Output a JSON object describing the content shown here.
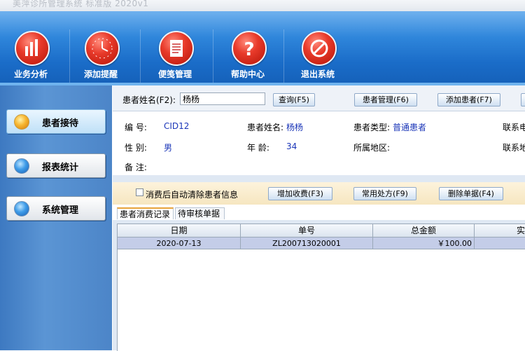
{
  "window": {
    "title": "美萍诊所管理系统 标准版   2020v1"
  },
  "toolbar": {
    "items": [
      {
        "label": "业务分析",
        "icon": "bar-chart-icon"
      },
      {
        "label": "添加提醒",
        "icon": "clock-icon"
      },
      {
        "label": "便笺管理",
        "icon": "notepad-icon"
      },
      {
        "label": "帮助中心",
        "icon": "help-icon"
      },
      {
        "label": "退出系统",
        "icon": "exit-icon"
      }
    ]
  },
  "sidebar": {
    "items": [
      {
        "label": "患者接待",
        "active": true
      },
      {
        "label": "报表统计",
        "active": false
      },
      {
        "label": "系统管理",
        "active": false
      }
    ]
  },
  "search": {
    "label": "患者姓名(F2):",
    "value": "杨杨",
    "query_btn": "查询(F5)",
    "manage_btn": "患者管理(F6)",
    "add_btn": "添加患者(F7)"
  },
  "patient": {
    "id_label": "编      号:",
    "id_value": "CID12",
    "name_label": "患者姓名:",
    "name_value": "杨杨",
    "type_label": "患者类型:",
    "type_value": "普通患者",
    "phone_label": "联系电",
    "sex_label": "性      别:",
    "sex_value": "男",
    "age_label": "年      龄:",
    "age_value": "34",
    "region_label": "所属地区:",
    "address_label": "联系地",
    "note_label": "备      注:"
  },
  "actions": {
    "auto_clear_label": "消费后自动清除患者信息",
    "add_fee_btn": "增加收费(F3)",
    "common_rx_btn": "常用处方(F9)",
    "delete_btn": "删除单据(F4)"
  },
  "tabs": [
    {
      "label": "患者消费记录",
      "active": true
    },
    {
      "label": "待审核单据",
      "active": false
    }
  ],
  "grid": {
    "columns": [
      "日期",
      "单号",
      "总金额",
      "实"
    ],
    "rows": [
      [
        "2020-07-13",
        "ZL200713020001",
        "￥100.00",
        ""
      ]
    ]
  },
  "colors": {
    "toolbar": "#1a6cc8",
    "sidebar": "#4c85c8",
    "value_text": "#1b36b8",
    "tab_accent": "#e8a33a",
    "selected_row": "#c4cde8"
  }
}
